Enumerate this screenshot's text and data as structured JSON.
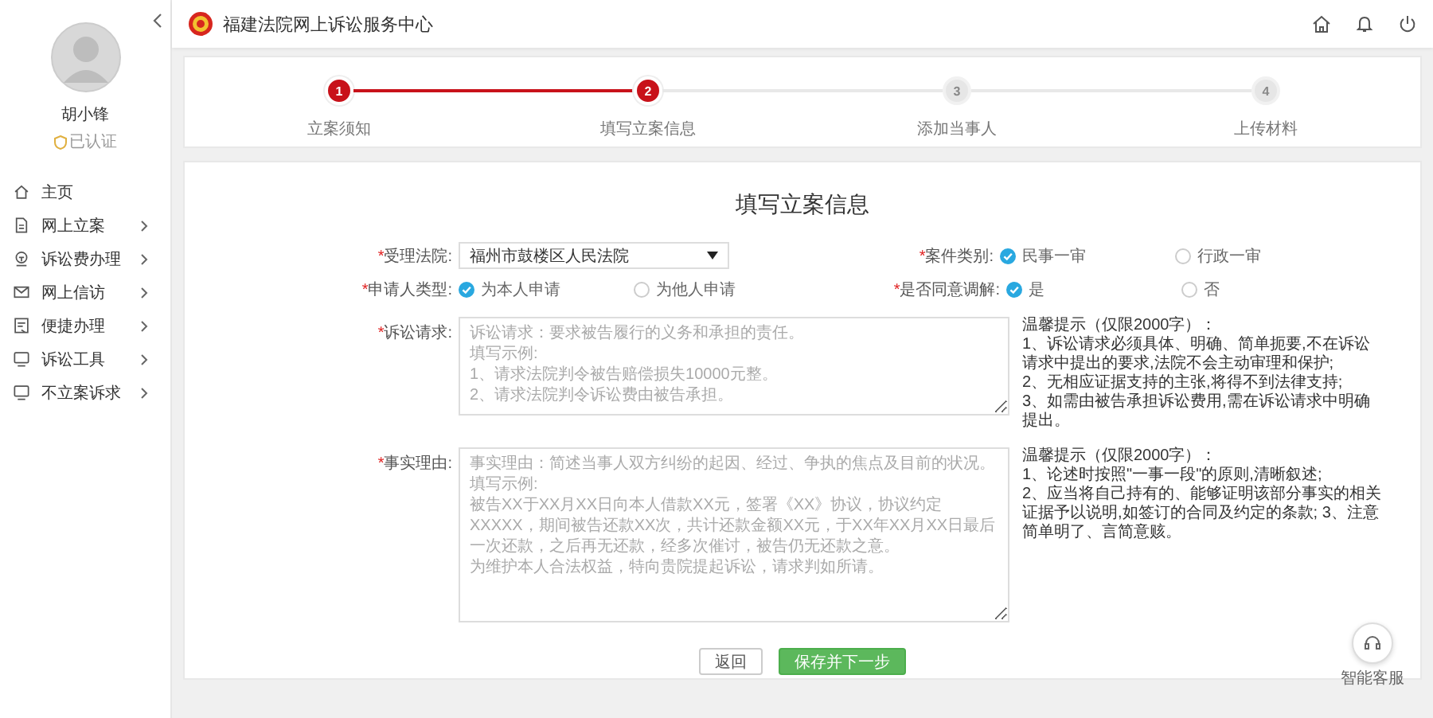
{
  "header": {
    "title": "福建法院网上诉讼服务中心"
  },
  "sidebar": {
    "user": {
      "name": "胡小锋",
      "badge": "已认证"
    },
    "items": [
      {
        "kind": "home",
        "label": "主页",
        "expandable": false
      },
      {
        "kind": "doc",
        "label": "网上立案",
        "expandable": true
      },
      {
        "kind": "fee",
        "label": "诉讼费办理",
        "expandable": true
      },
      {
        "kind": "mail",
        "label": "网上信访",
        "expandable": true
      },
      {
        "kind": "form",
        "label": "便捷办理",
        "expandable": true
      },
      {
        "kind": "tool",
        "label": "诉讼工具",
        "expandable": true
      },
      {
        "kind": "tool",
        "label": "不立案诉求",
        "expandable": true
      }
    ]
  },
  "steps": [
    {
      "number": "1",
      "label": "立案须知",
      "reached": true
    },
    {
      "number": "2",
      "label": "填写立案信息",
      "reached": true
    },
    {
      "number": "3",
      "label": "添加当事人",
      "reached": false
    },
    {
      "number": "4",
      "label": "上传材料",
      "reached": false
    }
  ],
  "form": {
    "title": "填写立案信息",
    "rows": [
      {
        "kind": "pair",
        "fields": [
          {
            "kind": "select",
            "mark": "*",
            "label": "受理法院:",
            "value": "福州市鼓楼区人民法院"
          },
          {
            "kind": "radio",
            "mark": "*",
            "label": "案件类别:",
            "options": [
              {
                "label": "民事一审",
                "selected": true
              },
              {
                "label": "行政一审",
                "selected": false
              }
            ]
          }
        ]
      },
      {
        "kind": "pair",
        "fields": [
          {
            "kind": "radio",
            "mark": "*",
            "label": "申请人类型:",
            "options": [
              {
                "label": "为本人申请",
                "selected": true
              },
              {
                "label": "为他人申请",
                "selected": false
              }
            ]
          },
          {
            "kind": "radio",
            "mark": "*",
            "label": "是否同意调解:",
            "options": [
              {
                "label": "是",
                "selected": true
              },
              {
                "label": "否",
                "selected": false
              }
            ]
          }
        ]
      },
      {
        "kind": "textarea",
        "mark": "*",
        "label": "诉讼请求:",
        "placeholder": [
          "诉讼请求：要求被告履行的义务和承担的责任。",
          "填写示例:",
          "1、请求法院判令被告赔偿损失10000元整。",
          "2、请求法院判令诉讼费由被告承担。"
        ],
        "hint": "温馨提示（仅限2000字）：\n1、诉讼请求必须具体、明确、简单扼要,不在诉讼请求中提出的要求,法院不会主动审理和保护;\n2、无相应证据支持的主张,将得不到法律支持;\n3、如需由被告承担诉讼费用,需在诉讼请求中明确提出。"
      },
      {
        "kind": "textarea",
        "mark": "*",
        "label": "事实理由:",
        "placeholder": [
          "事实理由：简述当事人双方纠纷的起因、经过、争执的焦点及目前的状况。",
          "填写示例:",
          "被告XX于XX月XX日向本人借款XX元，签署《XX》协议，协议约定 XXXXX，期间被告还款XX次，共计还款金额XX元，于XX年XX月XX日最后一次还款，之后再无还款，经多次催讨，被告仍无还款之意。",
          "为维护本人合法权益，特向贵院提起诉讼，请求判如所请。"
        ],
        "hint": "温馨提示（仅限2000字）：\n1、论述时按照\"一事一段\"的原则,清晰叙述;\n2、应当将自己持有的、能够证明该部分事实的相关证据予以说明,如签订的合同及约定的条款; 3、注意简单明了、言简意赅。"
      }
    ],
    "buttons": [
      {
        "kind": "secondary",
        "label": "返回"
      },
      {
        "kind": "primary",
        "label": "保存并下一步"
      }
    ]
  },
  "assistant": {
    "label": "智能客服"
  }
}
